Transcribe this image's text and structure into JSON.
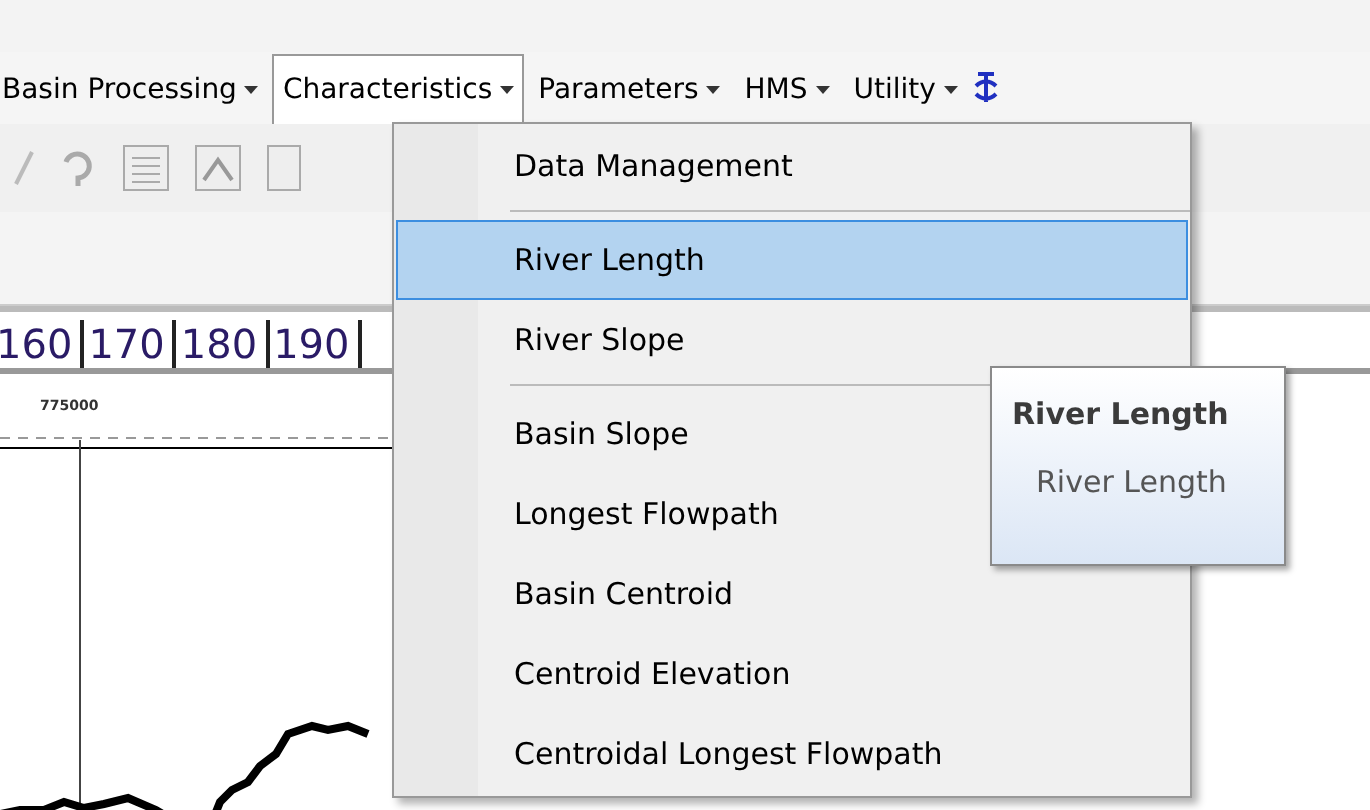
{
  "menubar": [
    {
      "label": "Basin Processing",
      "open": false
    },
    {
      "label": "Characteristics",
      "open": true
    },
    {
      "label": "Parameters",
      "open": false
    },
    {
      "label": "HMS",
      "open": false
    },
    {
      "label": "Utility",
      "open": false
    }
  ],
  "menu": [
    {
      "kind": "item",
      "label": "Data Management",
      "selected": false
    },
    {
      "kind": "separator"
    },
    {
      "kind": "item",
      "label": "River Length",
      "selected": true
    },
    {
      "kind": "item",
      "label": "River Slope",
      "selected": false
    },
    {
      "kind": "separator"
    },
    {
      "kind": "item",
      "label": "Basin Slope",
      "selected": false
    },
    {
      "kind": "item",
      "label": "Longest Flowpath",
      "selected": false
    },
    {
      "kind": "item",
      "label": "Basin Centroid",
      "selected": false
    },
    {
      "kind": "item",
      "label": "Centroid Elevation",
      "selected": false
    },
    {
      "kind": "item",
      "label": "Centroidal Longest Flowpath",
      "selected": false
    }
  ],
  "tooltip": {
    "title": "River Length",
    "text": "River Length"
  },
  "ruler": [
    "160",
    "170",
    "180",
    "190"
  ],
  "map": {
    "label": "775000"
  }
}
